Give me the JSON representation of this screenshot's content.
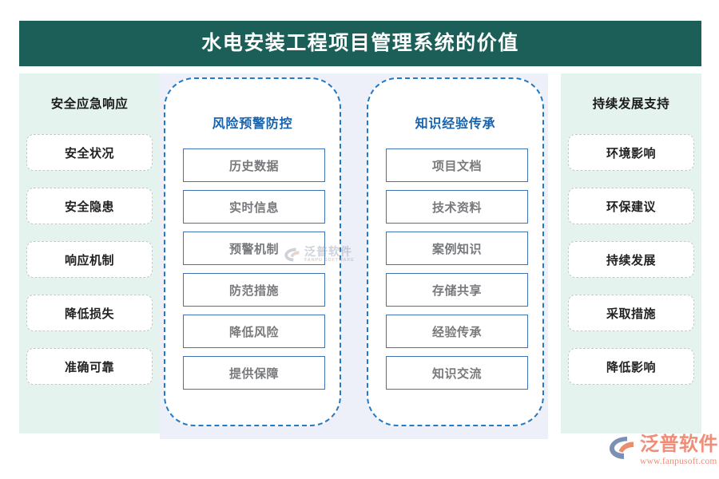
{
  "header": {
    "title": "水电安装工程项目管理系统的价值",
    "bg_color": "#1b5f58",
    "text_color": "#ffffff"
  },
  "left_panel": {
    "heading": "安全应急响应",
    "bg_color": "#e4f3ed",
    "items": [
      {
        "label": "安全状况"
      },
      {
        "label": "安全隐患"
      },
      {
        "label": "响应机制"
      },
      {
        "label": "降低损失"
      },
      {
        "label": "准确可靠"
      }
    ]
  },
  "center_panel": {
    "bg_color": "#edf0f9",
    "accent_color": "#2279c4",
    "groups": [
      {
        "heading": "风险预警防控",
        "items": [
          {
            "label": "历史数据"
          },
          {
            "label": "实时信息"
          },
          {
            "label": "预警机制"
          },
          {
            "label": "防范措施"
          },
          {
            "label": "降低风险"
          },
          {
            "label": "提供保障"
          }
        ]
      },
      {
        "heading": "知识经验传承",
        "items": [
          {
            "label": "项目文档"
          },
          {
            "label": "技术资料"
          },
          {
            "label": "案例知识"
          },
          {
            "label": "存储共享"
          },
          {
            "label": "经验传承"
          },
          {
            "label": "知识交流"
          }
        ]
      }
    ]
  },
  "right_panel": {
    "heading": "持续发展支持",
    "bg_color": "#e4f3ed",
    "items": [
      {
        "label": "环境影响"
      },
      {
        "label": "环保建议"
      },
      {
        "label": "持续发展"
      },
      {
        "label": "采取措施"
      },
      {
        "label": "降低影响"
      }
    ]
  },
  "watermark": {
    "brand_cn": "泛普软件",
    "brand_en": "FANPU SOFTWARE"
  },
  "logo": {
    "brand_cn": "泛普软件",
    "url": "www.fanpusoft.com",
    "color": "#ef8e78",
    "mark_color": "#7b90b4"
  }
}
